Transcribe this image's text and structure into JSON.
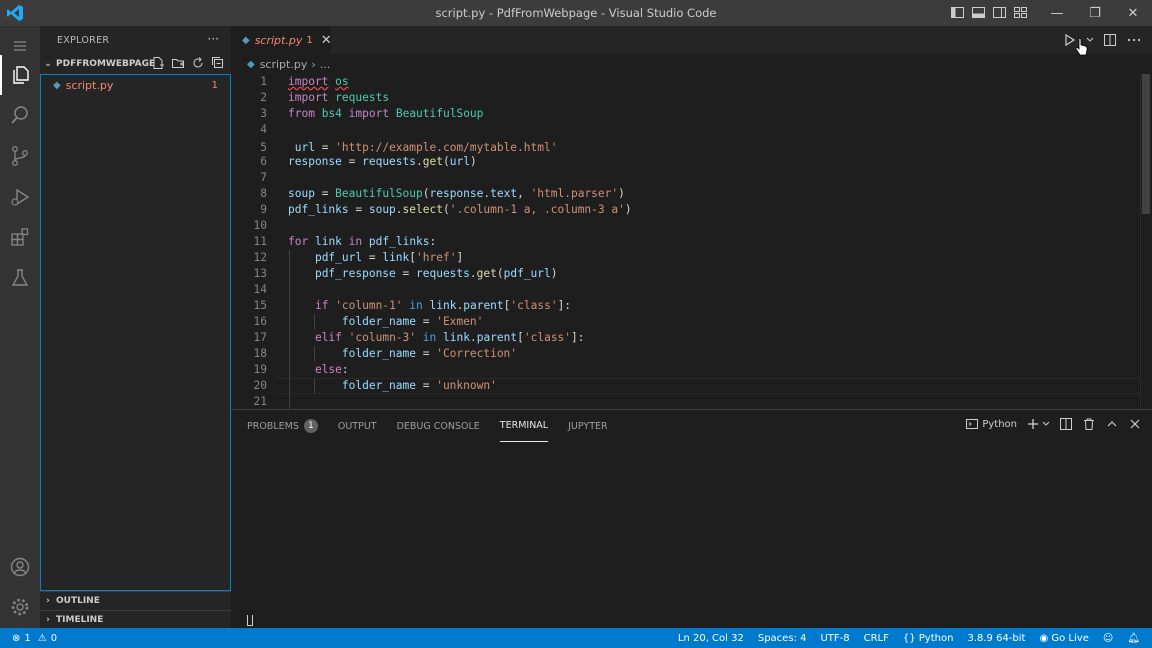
{
  "window": {
    "title": "script.py - PdfFromWebpage - Visual Studio Code",
    "minimize": "—",
    "restore": "❐",
    "close": "✕"
  },
  "sidebar": {
    "header": "EXPLORER",
    "more": "···",
    "project": "PDFFROMWEBPAGE",
    "files": [
      {
        "name": "script.py",
        "count": "1"
      }
    ],
    "outline": "OUTLINE",
    "timeline": "TIMELINE"
  },
  "editor": {
    "tab": {
      "name": "script.py",
      "count": "1",
      "close": "✕"
    },
    "breadcrumb": {
      "file": "script.py",
      "rest": "..."
    },
    "line_numbers": [
      "1",
      "2",
      "3",
      "4",
      "5",
      "6",
      "7",
      "8",
      "9",
      "10",
      "11",
      "12",
      "13",
      "14",
      "15",
      "16",
      "17",
      "18",
      "19",
      "20",
      "21"
    ]
  },
  "panel": {
    "tabs": [
      "PROBLEMS",
      "OUTPUT",
      "DEBUG CONSOLE",
      "TERMINAL",
      "JUPYTER"
    ],
    "problems_count": "1",
    "active_tab": "TERMINAL",
    "terminal_profile": "Python"
  },
  "statusbar": {
    "errors": "1",
    "warnings": "0",
    "position": "Ln 20, Col 32",
    "spaces": "Spaces: 4",
    "encoding": "UTF-8",
    "eol": "CRLF",
    "language": "Python",
    "interpreter": "3.8.9 64-bit",
    "golive": "Go Live"
  },
  "colors": {
    "accent": "#007acc",
    "error_text": "#f48771",
    "python_icon": "#519aba"
  }
}
